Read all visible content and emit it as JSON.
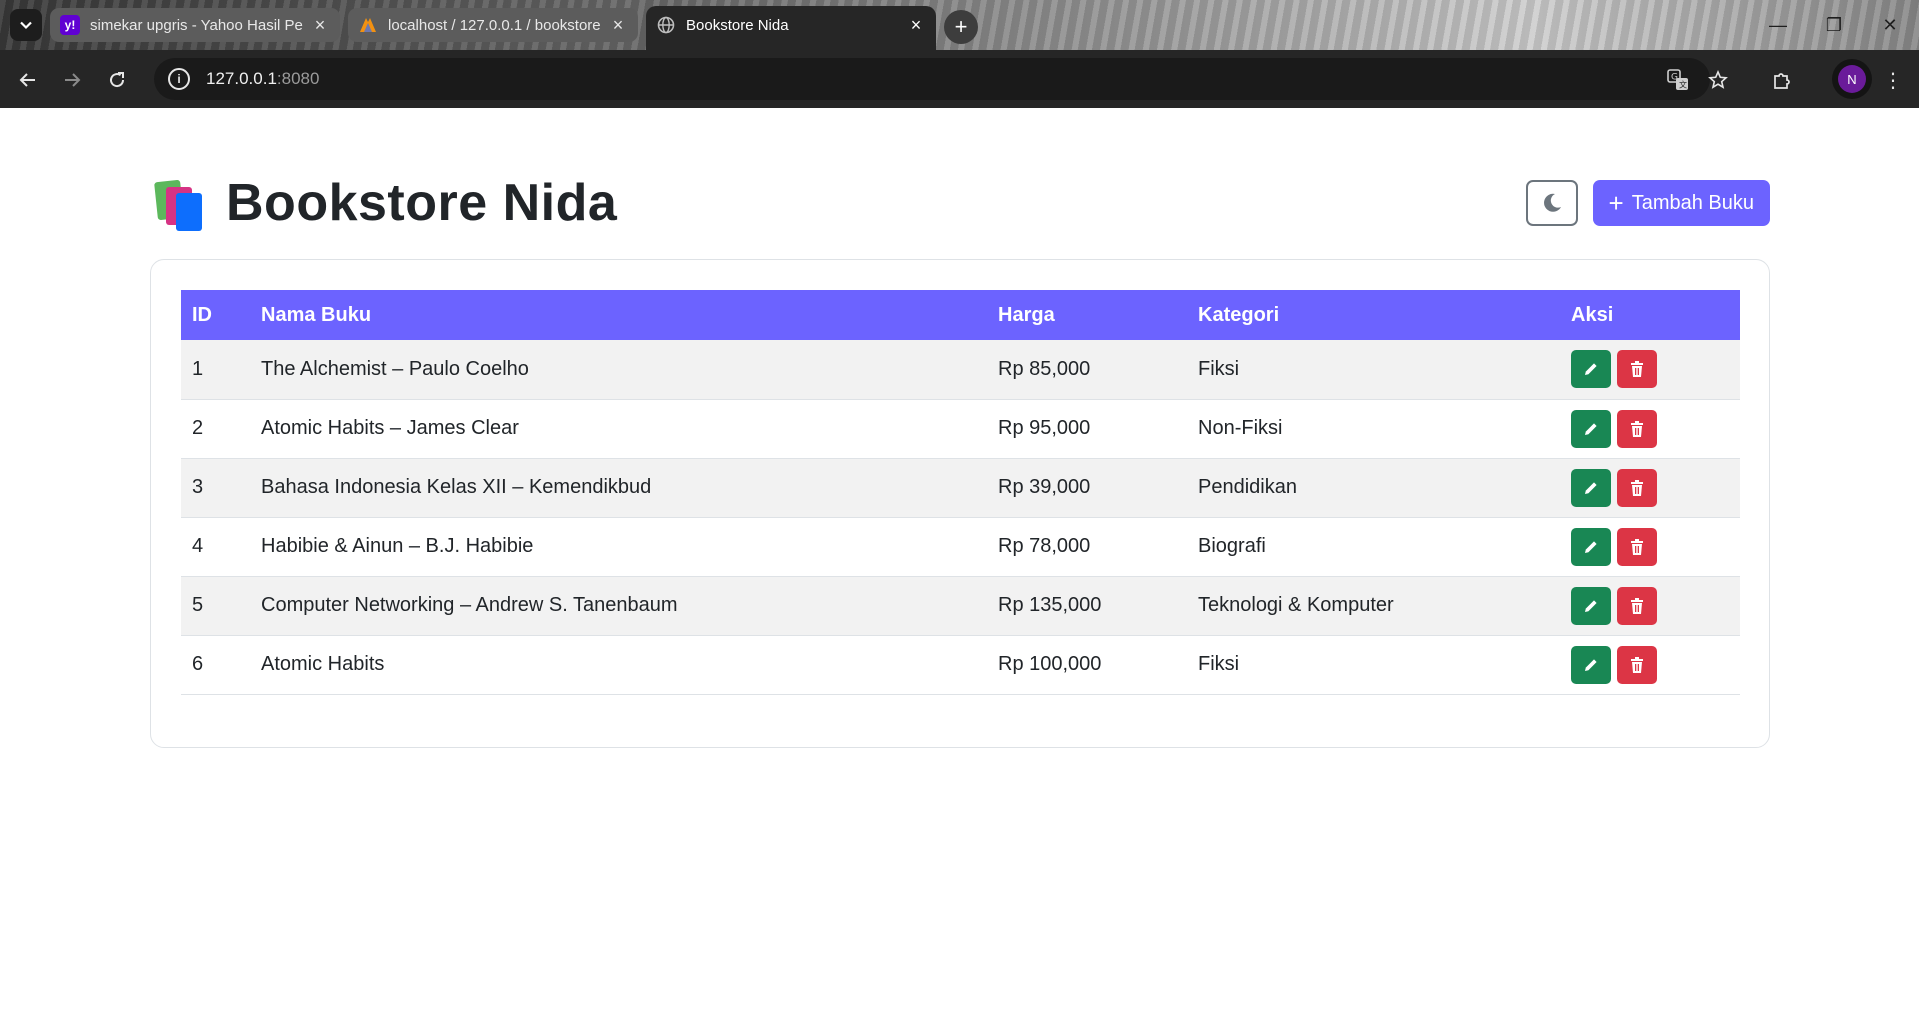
{
  "browser": {
    "tabs": [
      {
        "title": "simekar upgris - Yahoo Hasil Pe",
        "favicon": "yahoo-icon",
        "favicon_text": "y!",
        "color": "#6001d2"
      },
      {
        "title": "localhost / 127.0.0.1 / bookstore",
        "favicon": "phpmyadmin-icon",
        "color": "#f29111"
      },
      {
        "title": "Bookstore Nida",
        "favicon": "globe-icon",
        "active": true
      }
    ],
    "url_host": "127.0.0.1",
    "url_port": ":8080",
    "profile_initial": "N"
  },
  "header": {
    "title": "Bookstore Nida",
    "logo": "books-icon",
    "theme_toggle_icon": "moon-icon",
    "add_button_label": "Tambah Buku",
    "add_button_color": "#6c63ff"
  },
  "table": {
    "columns": [
      "ID",
      "Nama Buku",
      "Harga",
      "Kategori",
      "Aksi"
    ],
    "rows": [
      {
        "id": "1",
        "name": "The Alchemist – Paulo Coelho",
        "price": "Rp 85,000",
        "category": "Fiksi"
      },
      {
        "id": "2",
        "name": "Atomic Habits – James Clear",
        "price": "Rp 95,000",
        "category": "Non-Fiksi"
      },
      {
        "id": "3",
        "name": "Bahasa Indonesia Kelas XII – Kemendikbud",
        "price": "Rp 39,000",
        "category": "Pendidikan"
      },
      {
        "id": "4",
        "name": "Habibie & Ainun – B.J. Habibie",
        "price": "Rp 78,000",
        "category": "Biografi"
      },
      {
        "id": "5",
        "name": "Computer Networking – Andrew S. Tanenbaum",
        "price": "Rp 135,000",
        "category": "Teknologi & Komputer"
      },
      {
        "id": "6",
        "name": "Atomic Habits",
        "price": "Rp 100,000",
        "category": "Fiksi"
      }
    ],
    "edit_icon": "pencil-icon",
    "delete_icon": "trash-icon",
    "edit_color": "#198754",
    "delete_color": "#dc3545"
  }
}
